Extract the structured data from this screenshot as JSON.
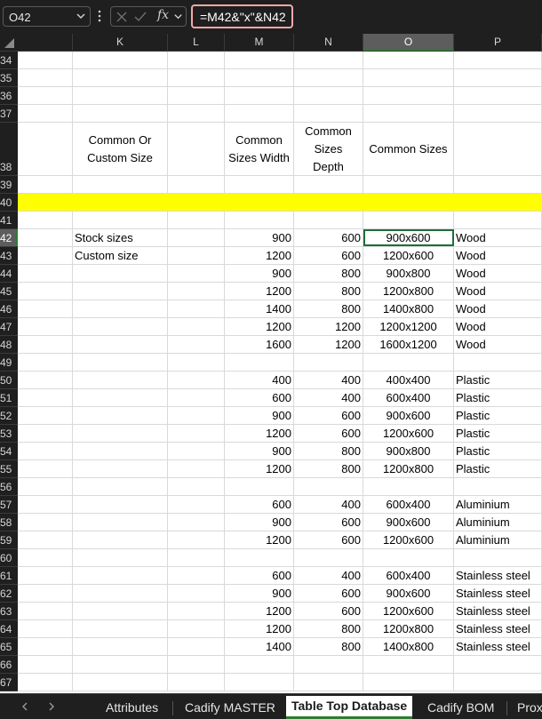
{
  "formula_bar": {
    "name_box": "O42",
    "fx_label": "fx",
    "formula": "=M42&\"x\"&N42"
  },
  "columns": [
    {
      "id": "K",
      "label": "K"
    },
    {
      "id": "L",
      "label": "L"
    },
    {
      "id": "M",
      "label": "M"
    },
    {
      "id": "N",
      "label": "N"
    },
    {
      "id": "O",
      "label": "O",
      "selected": true
    },
    {
      "id": "P",
      "label": "P"
    }
  ],
  "header_cells": {
    "K": "Common Or Custom Size",
    "M": "Common Sizes Width",
    "N": "Common Sizes Depth",
    "O": "Common Sizes"
  },
  "rows": [
    {
      "n": "34"
    },
    {
      "n": "35"
    },
    {
      "n": "36"
    },
    {
      "n": "37"
    },
    {
      "n": "38",
      "header": true
    },
    {
      "n": "39"
    },
    {
      "n": "40",
      "highlight": "#ffff00"
    },
    {
      "n": "41"
    },
    {
      "n": "42",
      "K": "Stock sizes",
      "M": "900",
      "N": "600",
      "O": "900x600",
      "P": "Wood",
      "selected": true
    },
    {
      "n": "43",
      "K": "Custom size",
      "M": "1200",
      "N": "600",
      "O": "1200x600",
      "P": "Wood"
    },
    {
      "n": "44",
      "M": "900",
      "N": "800",
      "O": "900x800",
      "P": "Wood"
    },
    {
      "n": "45",
      "M": "1200",
      "N": "800",
      "O": "1200x800",
      "P": "Wood"
    },
    {
      "n": "46",
      "M": "1400",
      "N": "800",
      "O": "1400x800",
      "P": "Wood"
    },
    {
      "n": "47",
      "M": "1200",
      "N": "1200",
      "O": "1200x1200",
      "P": "Wood"
    },
    {
      "n": "48",
      "M": "1600",
      "N": "1200",
      "O": "1600x1200",
      "P": "Wood"
    },
    {
      "n": "49"
    },
    {
      "n": "50",
      "M": "400",
      "N": "400",
      "O": "400x400",
      "P": "Plastic"
    },
    {
      "n": "51",
      "M": "600",
      "N": "400",
      "O": "600x400",
      "P": "Plastic"
    },
    {
      "n": "52",
      "M": "900",
      "N": "600",
      "O": "900x600",
      "P": "Plastic"
    },
    {
      "n": "53",
      "M": "1200",
      "N": "600",
      "O": "1200x600",
      "P": "Plastic"
    },
    {
      "n": "54",
      "M": "900",
      "N": "800",
      "O": "900x800",
      "P": "Plastic"
    },
    {
      "n": "55",
      "M": "1200",
      "N": "800",
      "O": "1200x800",
      "P": "Plastic"
    },
    {
      "n": "56"
    },
    {
      "n": "57",
      "M": "600",
      "N": "400",
      "O": "600x400",
      "P": "Aluminium"
    },
    {
      "n": "58",
      "M": "900",
      "N": "600",
      "O": "900x600",
      "P": "Aluminium"
    },
    {
      "n": "59",
      "M": "1200",
      "N": "600",
      "O": "1200x600",
      "P": "Aluminium"
    },
    {
      "n": "60"
    },
    {
      "n": "61",
      "M": "600",
      "N": "400",
      "O": "600x400",
      "P": "Stainless steel"
    },
    {
      "n": "62",
      "M": "900",
      "N": "600",
      "O": "900x600",
      "P": "Stainless steel"
    },
    {
      "n": "63",
      "M": "1200",
      "N": "600",
      "O": "1200x600",
      "P": "Stainless steel"
    },
    {
      "n": "64",
      "M": "1200",
      "N": "800",
      "O": "1200x800",
      "P": "Stainless steel"
    },
    {
      "n": "65",
      "M": "1400",
      "N": "800",
      "O": "1400x800",
      "P": "Stainless steel"
    },
    {
      "n": "66"
    },
    {
      "n": "67"
    }
  ],
  "sheet_tabs": [
    {
      "label": "Attributes",
      "active": false
    },
    {
      "label": "Cadify MASTER",
      "active": false
    },
    {
      "label": "Table Top Database",
      "active": true
    },
    {
      "label": "Cadify BOM",
      "active": false
    },
    {
      "label": "Prox",
      "active": false
    }
  ],
  "colors": {
    "selection_green": "#2e7d32",
    "highlight_yellow": "#ffff00",
    "chrome_dark": "#1f1f1f"
  }
}
